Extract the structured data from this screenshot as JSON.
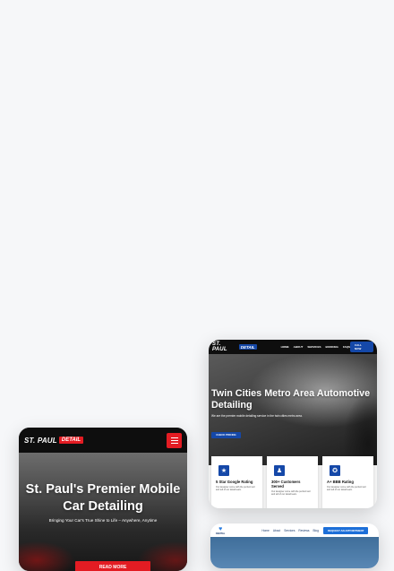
{
  "mobile": {
    "logo_text": "ST. PAUL",
    "logo_badge": "DETAIL",
    "hero_title": "St. Paul's Premier Mobile Car Detailing",
    "hero_subtitle": "Bringing Your Car's True Shine to Life – Anywhere, Anytime",
    "cta": "READ MORE"
  },
  "desktop": {
    "logo_text": "ST. PAUL",
    "logo_badge": "DETAIL",
    "nav": [
      "HOME",
      "ABOUT",
      "SERVICES",
      "BOOKING",
      "FAQS"
    ],
    "call": "CALL NOW",
    "hero_title": "Twin Cities Metro Area Automotive Detailing",
    "hero_subtitle": "We are the premier mobile detailing service in the twin cities metro area.",
    "cta": "CHECK PRICING",
    "features": [
      {
        "title": "5 Star Google Rating",
        "desc": "Our designer come with the perfect tool and tell of our detail team.",
        "icon": "star-icon"
      },
      {
        "title": "300+ Customers Served",
        "desc": "Our designer come with the perfect tool and tell of our detail team.",
        "icon": "user-icon"
      },
      {
        "title": "A+ BBB Rating",
        "desc": "Our designer come with the perfect tool and tell of our detail team.",
        "icon": "badge-icon"
      }
    ]
  },
  "dental": {
    "logo_text": "DENTAL",
    "nav": [
      "Home",
      "About",
      "Services",
      "Reviews",
      "Blog"
    ],
    "cta": "REQUEST AN APPOINTMENT"
  }
}
